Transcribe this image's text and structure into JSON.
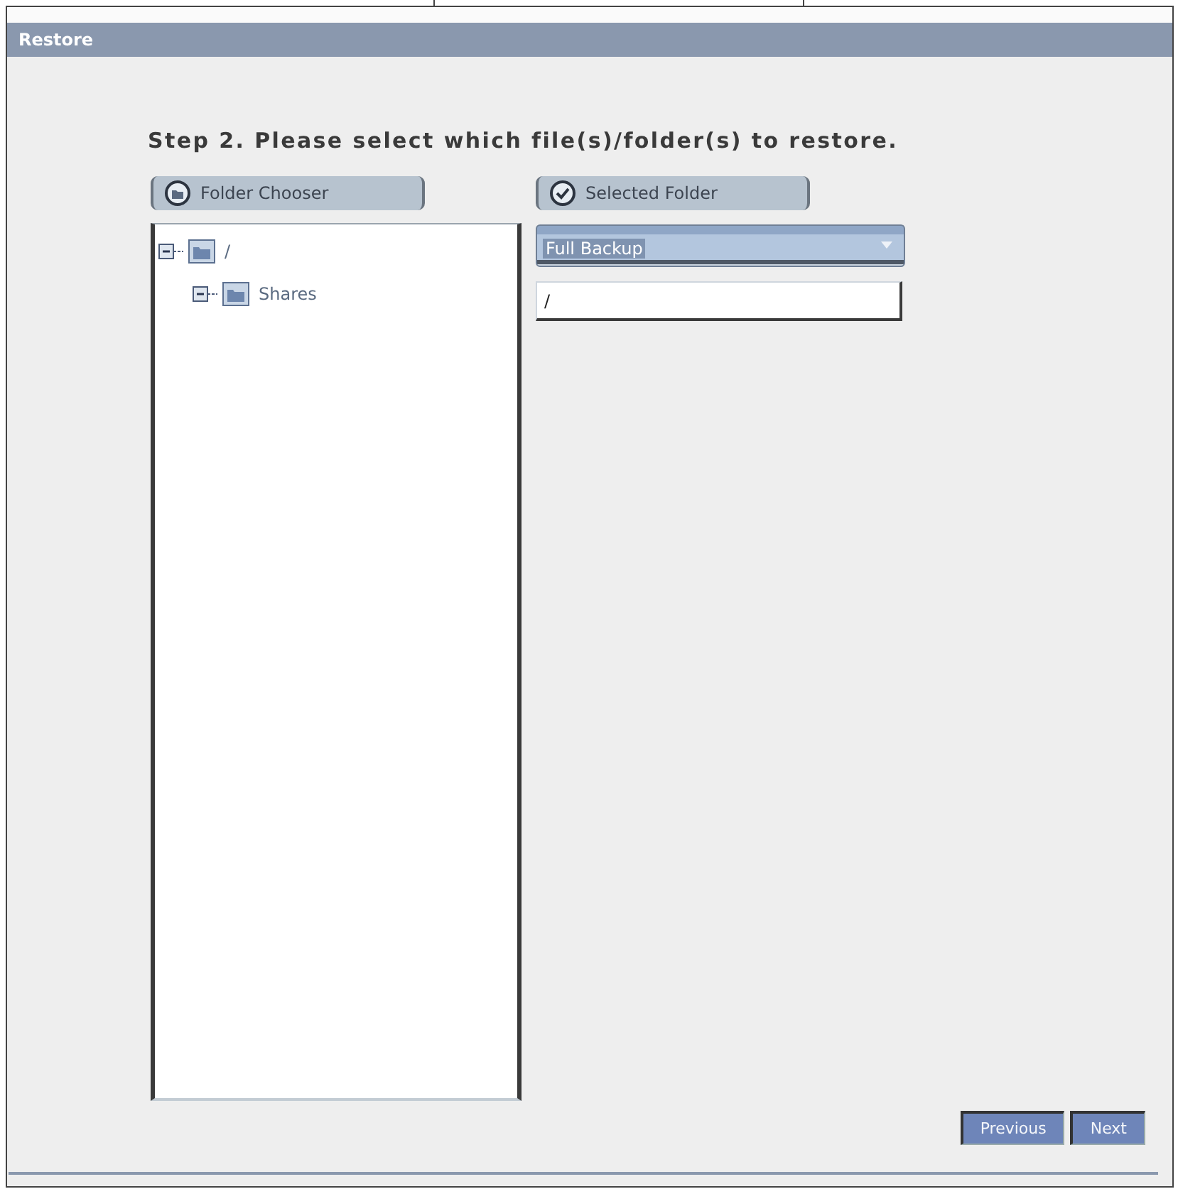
{
  "window": {
    "title": "Restore"
  },
  "instruction": "Step 2. Please select which file(s)/folder(s) to restore.",
  "folder_chooser": {
    "label": "Folder Chooser",
    "tree": [
      {
        "label": "/",
        "expanded": true,
        "children": [
          {
            "label": "Shares",
            "expanded": true
          }
        ]
      }
    ]
  },
  "selected_folder": {
    "label": "Selected Folder",
    "dropdown": {
      "value": "Full Backup"
    },
    "path": {
      "value": "/"
    }
  },
  "buttons": [
    {
      "label": "Previous"
    },
    {
      "label": "Next"
    }
  ]
}
